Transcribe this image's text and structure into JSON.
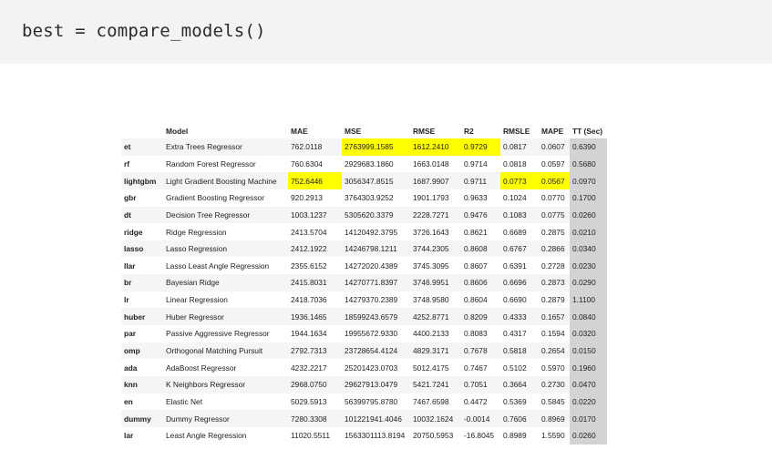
{
  "code": "best = compare_models()",
  "columns": [
    "",
    "Model",
    "MAE",
    "MSE",
    "RMSE",
    "R2",
    "RMSLE",
    "MAPE",
    "TT (Sec)"
  ],
  "highlight_color": "#ffff00",
  "tt_background": "#d3d3d3",
  "rows": [
    {
      "id": "et",
      "model": "Extra Trees Regressor",
      "mae": "762.0118",
      "mse": "2763999.1585",
      "rmse": "1612.2410",
      "r2": "0.9729",
      "rmsle": "0.0817",
      "mape": "0.0607",
      "tt": "0.6390",
      "highlight": [
        "mse",
        "rmse",
        "r2"
      ]
    },
    {
      "id": "rf",
      "model": "Random Forest Regressor",
      "mae": "760.6304",
      "mse": "2929683.1860",
      "rmse": "1663.0148",
      "r2": "0.9714",
      "rmsle": "0.0818",
      "mape": "0.0597",
      "tt": "0.5680",
      "highlight": []
    },
    {
      "id": "lightgbm",
      "model": "Light Gradient Boosting Machine",
      "mae": "752.6446",
      "mse": "3056347.8515",
      "rmse": "1687.9907",
      "r2": "0.9711",
      "rmsle": "0.0773",
      "mape": "0.0567",
      "tt": "0.0970",
      "highlight": [
        "mae",
        "rmsle",
        "mape"
      ]
    },
    {
      "id": "gbr",
      "model": "Gradient Boosting Regressor",
      "mae": "920.2913",
      "mse": "3764303.9252",
      "rmse": "1901.1793",
      "r2": "0.9633",
      "rmsle": "0.1024",
      "mape": "0.0770",
      "tt": "0.1700",
      "highlight": []
    },
    {
      "id": "dt",
      "model": "Decision Tree Regressor",
      "mae": "1003.1237",
      "mse": "5305620.3379",
      "rmse": "2228.7271",
      "r2": "0.9476",
      "rmsle": "0.1083",
      "mape": "0.0775",
      "tt": "0.0260",
      "highlight": []
    },
    {
      "id": "ridge",
      "model": "Ridge Regression",
      "mae": "2413.5704",
      "mse": "14120492.3795",
      "rmse": "3726.1643",
      "r2": "0.8621",
      "rmsle": "0.6689",
      "mape": "0.2875",
      "tt": "0.0210",
      "highlight": []
    },
    {
      "id": "lasso",
      "model": "Lasso Regression",
      "mae": "2412.1922",
      "mse": "14246798.1211",
      "rmse": "3744.2305",
      "r2": "0.8608",
      "rmsle": "0.6767",
      "mape": "0.2866",
      "tt": "0.0340",
      "highlight": []
    },
    {
      "id": "llar",
      "model": "Lasso Least Angle Regression",
      "mae": "2355.6152",
      "mse": "14272020.4389",
      "rmse": "3745.3095",
      "r2": "0.8607",
      "rmsle": "0.6391",
      "mape": "0.2728",
      "tt": "0.0230",
      "highlight": []
    },
    {
      "id": "br",
      "model": "Bayesian Ridge",
      "mae": "2415.8031",
      "mse": "14270771.8397",
      "rmse": "3746.9951",
      "r2": "0.8606",
      "rmsle": "0.6696",
      "mape": "0.2873",
      "tt": "0.0290",
      "highlight": []
    },
    {
      "id": "lr",
      "model": "Linear Regression",
      "mae": "2418.7036",
      "mse": "14279370.2389",
      "rmse": "3748.9580",
      "r2": "0.8604",
      "rmsle": "0.6690",
      "mape": "0.2879",
      "tt": "1.1100",
      "highlight": []
    },
    {
      "id": "huber",
      "model": "Huber Regressor",
      "mae": "1936.1465",
      "mse": "18599243.6579",
      "rmse": "4252.8771",
      "r2": "0.8209",
      "rmsle": "0.4333",
      "mape": "0.1657",
      "tt": "0.0840",
      "highlight": []
    },
    {
      "id": "par",
      "model": "Passive Aggressive Regressor",
      "mae": "1944.1634",
      "mse": "19955672.9330",
      "rmse": "4400.2133",
      "r2": "0.8083",
      "rmsle": "0.4317",
      "mape": "0.1594",
      "tt": "0.0320",
      "highlight": []
    },
    {
      "id": "omp",
      "model": "Orthogonal Matching Pursuit",
      "mae": "2792.7313",
      "mse": "23728654.4124",
      "rmse": "4829.3171",
      "r2": "0.7678",
      "rmsle": "0.5818",
      "mape": "0.2654",
      "tt": "0.0150",
      "highlight": []
    },
    {
      "id": "ada",
      "model": "AdaBoost Regressor",
      "mae": "4232.2217",
      "mse": "25201423.0703",
      "rmse": "5012.4175",
      "r2": "0.7467",
      "rmsle": "0.5102",
      "mape": "0.5970",
      "tt": "0.1960",
      "highlight": []
    },
    {
      "id": "knn",
      "model": "K Neighbors Regressor",
      "mae": "2968.0750",
      "mse": "29627913.0479",
      "rmse": "5421.7241",
      "r2": "0.7051",
      "rmsle": "0.3664",
      "mape": "0.2730",
      "tt": "0.0470",
      "highlight": []
    },
    {
      "id": "en",
      "model": "Elastic Net",
      "mae": "5029.5913",
      "mse": "56399795.8780",
      "rmse": "7467.6598",
      "r2": "0.4472",
      "rmsle": "0.5369",
      "mape": "0.5845",
      "tt": "0.0220",
      "highlight": []
    },
    {
      "id": "dummy",
      "model": "Dummy Regressor",
      "mae": "7280.3308",
      "mse": "101221941.4046",
      "rmse": "10032.1624",
      "r2": "-0.0014",
      "rmsle": "0.7606",
      "mape": "0.8969",
      "tt": "0.0170",
      "highlight": []
    },
    {
      "id": "lar",
      "model": "Least Angle Regression",
      "mae": "11020.5511",
      "mse": "1563301113.8194",
      "rmse": "20750.5953",
      "r2": "-16.8045",
      "rmsle": "0.8989",
      "mape": "1.5590",
      "tt": "0.0260",
      "highlight": []
    }
  ]
}
